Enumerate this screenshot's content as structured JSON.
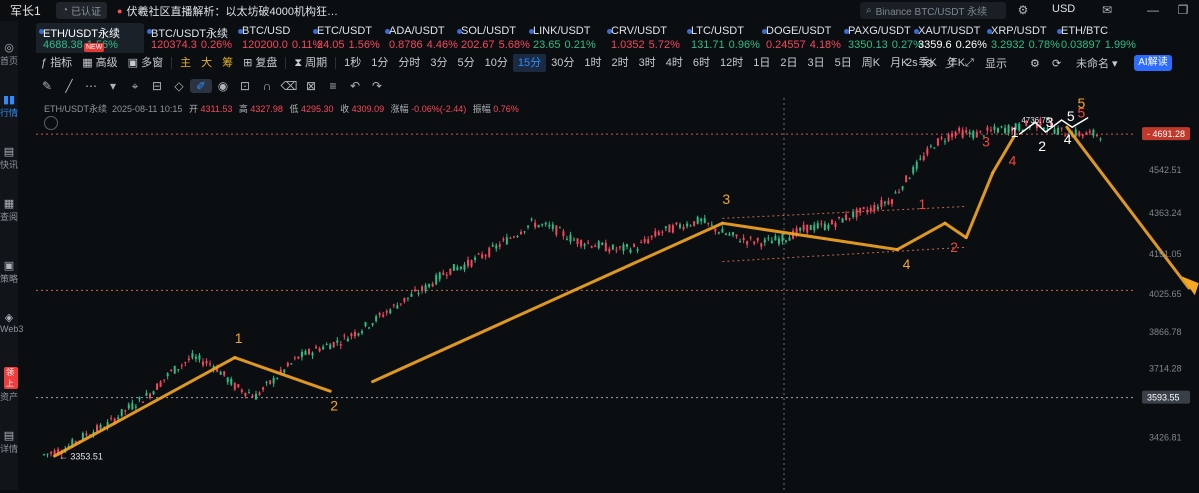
{
  "topbar": {
    "user": "军长1",
    "status_pill": "已认证",
    "news": "伏羲社区直播解析：以太坊破4000机构狂…",
    "search_placeholder": "Binance BTC/USDT 永续",
    "currency": "USD"
  },
  "sidebar": {
    "items": [
      "首页",
      "行情",
      "快讯",
      "查阅",
      "策略",
      "Web3",
      "资产",
      "详情"
    ],
    "badge": "领上"
  },
  "tabs": [
    {
      "symbol": "ETH/USDT永续",
      "price": "4688.38",
      "change": "1.56%",
      "dir": "up",
      "badge": "NEW"
    },
    {
      "symbol": "BTC/USDT永续",
      "price": "120374.3",
      "change": "0.26%",
      "dir": "dn"
    },
    {
      "symbol": "BTC/USD",
      "price": "120200.0",
      "change": "0.11%",
      "dir": "dn"
    },
    {
      "symbol": "ETC/USDT",
      "price": "24.05",
      "change": "1.56%",
      "dir": "dn"
    },
    {
      "symbol": "ADA/USDT",
      "price": "0.8786",
      "change": "4.46%",
      "dir": "dn"
    },
    {
      "symbol": "SOL/USDT",
      "price": "202.67",
      "change": "5.68%",
      "dir": "dn"
    },
    {
      "symbol": "LINK/USDT",
      "price": "23.65",
      "change": "0.21%",
      "dir": "up"
    },
    {
      "symbol": "CRV/USDT",
      "price": "1.0352",
      "change": "5.72%",
      "dir": "dn"
    },
    {
      "symbol": "LTC/USDT",
      "price": "131.71",
      "change": "0.96%",
      "dir": "up"
    },
    {
      "symbol": "DOGE/USDT",
      "price": "0.24557",
      "change": "4.18%",
      "dir": "dn"
    },
    {
      "symbol": "PAXG/USDT",
      "price": "3350.13",
      "change": "0.27%",
      "dir": "up"
    },
    {
      "symbol": "XAUT/USDT",
      "price": "3359.6",
      "change": "0.26%",
      "dir": "white"
    },
    {
      "symbol": "XRP/USDT",
      "price": "3.2932",
      "change": "0.78%",
      "dir": "up"
    },
    {
      "symbol": "ETH/BTC",
      "price": "0.03897",
      "change": "1.99%",
      "dir": "up"
    }
  ],
  "toolbar": {
    "left": [
      "指标",
      "高级",
      "多窗",
      "主",
      "大",
      "筹",
      "复盘",
      "周期",
      "1秒",
      "1分",
      "分时",
      "3分",
      "5分",
      "10分",
      "15分",
      "30分",
      "1时",
      "2时",
      "3时",
      "4时",
      "6时",
      "12时",
      "1日",
      "2日",
      "3日",
      "5日",
      "周K",
      "月K",
      "季K",
      "年K"
    ],
    "selected": "15分",
    "right": [
      "2s",
      "显示",
      "未命名"
    ],
    "ai_button": "AI解读"
  },
  "ohlc": {
    "symbol": "ETH/USDT永续",
    "datetime": "2025-08-11 10:15",
    "open_label": "开",
    "open": "4311.53",
    "high_label": "高",
    "high": "4327.98",
    "low_label": "低",
    "low": "4295.30",
    "close_label": "收",
    "close": "4309.09",
    "chg_label": "涨幅",
    "chg": "-0.06%(-2.44)",
    "amp_label": "振幅",
    "amp": "0.76%"
  },
  "chart_data": {
    "type": "line",
    "title": "ETH/USDT永续",
    "y_ticks": [
      "4542.51",
      "4363.24",
      "4191.05",
      "4025.65",
      "3866.78",
      "3714.28",
      "3426.81"
    ],
    "current_price": "4691.28",
    "crosshair_price": "3593.55",
    "low_marker": "3353.51",
    "high_marker": "4736.78",
    "series": [
      {
        "name": "",
        "x": [
          0,
          20,
          40,
          60,
          80,
          100,
          120,
          140,
          160,
          180,
          200,
          220,
          240,
          260,
          280,
          300,
          320,
          340,
          360,
          380,
          400,
          420,
          440,
          460,
          480,
          500,
          520,
          540,
          560,
          580,
          600,
          620,
          640,
          660,
          680,
          700,
          720,
          740,
          760,
          780,
          800,
          820,
          840,
          860,
          880,
          900,
          920,
          940,
          960,
          980,
          1000
        ],
        "y": [
          3355,
          3380,
          3440,
          3480,
          3550,
          3610,
          3700,
          3760,
          3730,
          3640,
          3600,
          3680,
          3760,
          3800,
          3830,
          3880,
          3940,
          4000,
          4050,
          4120,
          4150,
          4200,
          4260,
          4320,
          4300,
          4250,
          4230,
          4210,
          4220,
          4280,
          4310,
          4330,
          4280,
          4250,
          4240,
          4260,
          4300,
          4310,
          4350,
          4380,
          4420,
          4540,
          4650,
          4700,
          4690,
          4710,
          4720,
          4736,
          4700,
          4690,
          4691
        ]
      }
    ],
    "wave_labels": {
      "orange": [
        "1",
        "2",
        "3",
        "4",
        "5"
      ],
      "red": [
        "1",
        "2",
        "3",
        "4",
        "5"
      ],
      "white": [
        "1",
        "2",
        "3",
        "4",
        "5"
      ]
    },
    "colors": {
      "orange": "#f5a623",
      "red": "#f0443a",
      "white": "#ffffff",
      "candle_up": "#2ebd85",
      "candle_dn": "#f6465d"
    }
  }
}
